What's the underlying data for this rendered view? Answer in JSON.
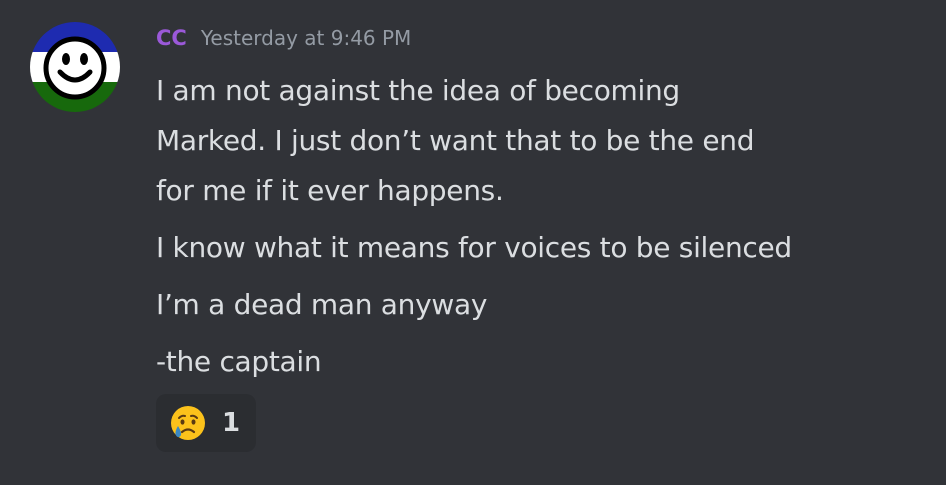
{
  "message": {
    "author": {
      "name": "CC",
      "color": "#9b59d9",
      "avatar_icon": "smiley-face-flag-avatar",
      "avatar_colors": [
        "#1e2bb0",
        "#ffffff",
        "#17690c"
      ]
    },
    "timestamp": "Yesterday at 9:46 PM",
    "lines": [
      "I am not against the idea of becoming",
      "Marked. I just don’t want that to be the end",
      "for me if it ever happens.",
      "I know what it means for voices to be silenced",
      "I’m a dead man anyway",
      "-the captain"
    ],
    "reactions": [
      {
        "emoji_icon": "sad-but-relieved-face-icon",
        "count": "1"
      }
    ]
  }
}
